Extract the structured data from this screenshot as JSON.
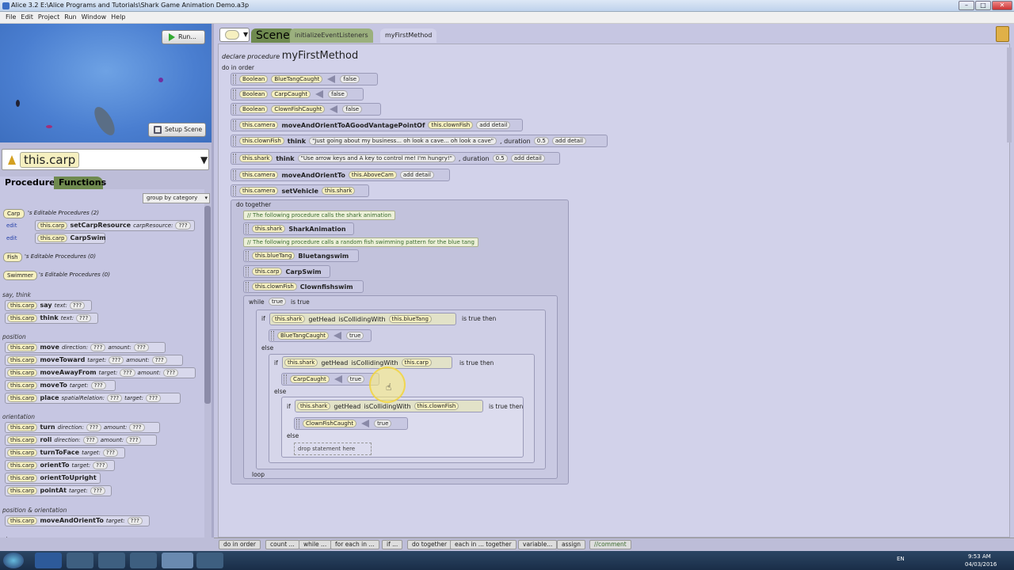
{
  "window": {
    "title": "Alice  3.2 E:\\Alice Programs and Tutorials\\Shark Game Animation Demo.a3p",
    "minimize": "–",
    "maximize": "□",
    "close": "✕"
  },
  "menu": [
    "File",
    "Edit",
    "Project",
    "Run",
    "Window",
    "Help"
  ],
  "scene": {
    "run_label": "Run...",
    "setup_label": "Setup Scene"
  },
  "selector": {
    "value": "this.carp",
    "arrow": "▼"
  },
  "tabs": {
    "procedures": "Procedures",
    "functions": "Functions"
  },
  "group_by": "group by category",
  "procedures": {
    "carp_class": "Carp",
    "carp_editable": "'s Editable Procedures (2)",
    "edit": "edit",
    "p1_target": "this.carp",
    "p1_name": "setCarpResource",
    "p1_param": "carpResource:",
    "q": "???",
    "p2_target": "this.carp",
    "p2_name": "CarpSwim",
    "fish_class": "Fish",
    "fish_editable": "'s Editable Procedures (0)",
    "swimmer_class": "Swimmer",
    "swimmer_editable": "'s Editable Procedures (0)",
    "cat_say": "say, think",
    "cat_position": "position",
    "cat_orientation": "orientation",
    "cat_posor": "position & orientation",
    "cat_size": "size",
    "t": "this.carp",
    "say": "say",
    "think": "think",
    "text": "text:",
    "move": "move",
    "direction": "direction:",
    "amount": "amount:",
    "moveToward": "moveToward",
    "target": "target:",
    "moveAwayFrom": "moveAwayFrom",
    "moveTo": "moveTo",
    "place": "place",
    "spatialRelation": "spatialRelation:",
    "turn": "turn",
    "roll": "roll",
    "turnToFace": "turnToFace",
    "orientTo": "orientTo",
    "orientToUpright": "orientToUpright",
    "pointAt": "pointAt",
    "moveAndOrientTo": "moveAndOrientTo"
  },
  "editor_tabs": {
    "scene": "Scene",
    "init": "initializeEventListeners",
    "method": "myFirstMethod"
  },
  "code": {
    "declare": "declare procedure",
    "method": "myFirstMethod",
    "do_in_order": "do in order",
    "boolean": "Boolean",
    "bluetang_caught": "BlueTangCaught",
    "carp_caught": "CarpCaught",
    "clownfish_caught": "ClownFishCaught",
    "false": "false",
    "true": "true",
    "this_camera": "this.camera",
    "this_clownfish": "this.clownFish",
    "this_shark": "this.shark",
    "this_bluetang": "this.blueTang",
    "this_carp": "this.carp",
    "moveAndOrient": "moveAndOrientToAGoodVantagePointOf",
    "add_detail": "add detail",
    "think": "think",
    "clown_text": "\"Just going about my business... oh look a cave... oh look a cave\"",
    "duration": ", duration",
    "dur_val": "0.5",
    "shark_text": "\"Use arrow keys and A key to control me! I'm hungry!\"",
    "moveAndOrientTo": "moveAndOrientTo",
    "above_cam": "this.AboveCam",
    "setVehicle": "setVehicle",
    "do_together": "do together",
    "comment1": "// The following procedure calls the shark animation",
    "shark_anim": "SharkAnimation",
    "comment2": "// The following procedure calls a random fish swimming pattern for the blue tang",
    "bluetangswim": "Bluetangswim",
    "carpswim": "CarpSwim",
    "clownfishswim": "Clownfishswim",
    "while": "while",
    "is_true": "is true",
    "if": "if",
    "getHead": "getHead",
    "isCollidingWith": "isCollidingWith",
    "is_true_then": "is true then",
    "else": "else",
    "drop": "drop statement here",
    "loop": "loop"
  },
  "bottom": [
    "do in order",
    "count ...",
    "while ...",
    "for each in ...",
    "if ...",
    "do together",
    "each in ... together",
    "variable...",
    "assign",
    "//comment"
  ],
  "tray": {
    "lang": "EN",
    "time": "9:53 AM",
    "date": "04/03/2016"
  }
}
